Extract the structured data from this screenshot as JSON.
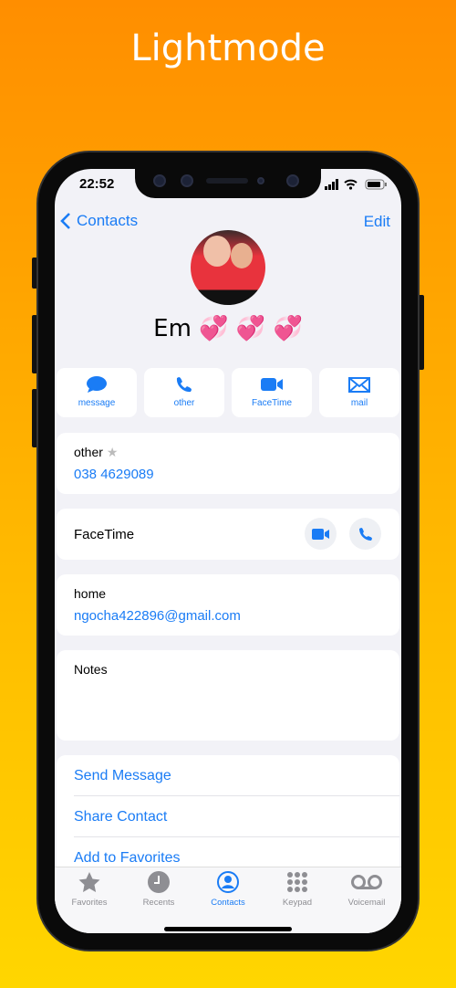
{
  "banner_title": "Lightmode",
  "status": {
    "time": "22:52"
  },
  "nav": {
    "back_label": "Contacts",
    "edit_label": "Edit"
  },
  "contact": {
    "name": "Em 💞 💞 💞"
  },
  "actions": [
    {
      "label": "message",
      "icon": "message-bubble-icon"
    },
    {
      "label": "other",
      "icon": "phone-icon"
    },
    {
      "label": "FaceTime",
      "icon": "video-icon"
    },
    {
      "label": "mail",
      "icon": "envelope-icon"
    }
  ],
  "phone": {
    "label": "other",
    "star": "★",
    "number": "038 4629089"
  },
  "facetime": {
    "label": "FaceTime"
  },
  "email": {
    "label": "home",
    "value": "ngocha422896@gmail.com"
  },
  "notes": {
    "label": "Notes"
  },
  "links": [
    "Send Message",
    "Share Contact",
    "Add to Favorites"
  ],
  "tabs": [
    {
      "label": "Favorites",
      "active": false
    },
    {
      "label": "Recents",
      "active": false
    },
    {
      "label": "Contacts",
      "active": true
    },
    {
      "label": "Keypad",
      "active": false
    },
    {
      "label": "Voicemail",
      "active": false
    }
  ],
  "colors": {
    "accent": "#1a7cf5",
    "inactive": "#8e8e93"
  }
}
